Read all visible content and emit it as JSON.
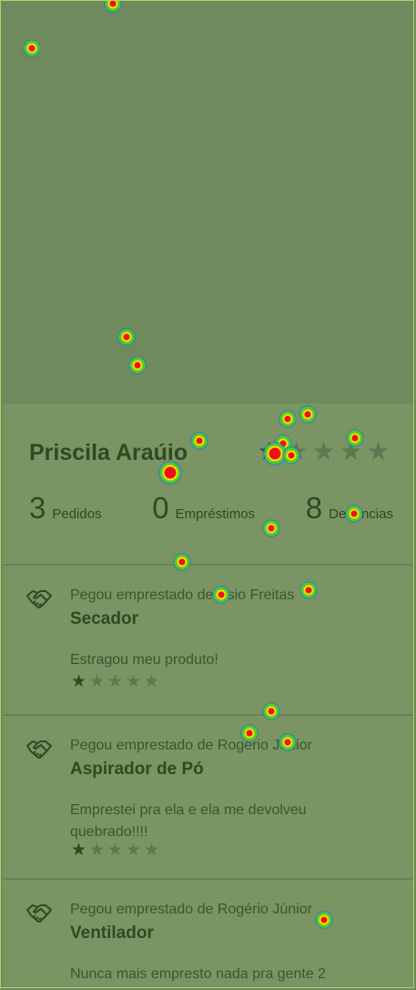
{
  "profile": {
    "name": "Priscila Araúio",
    "rating_filled": 1,
    "rating_max": 5,
    "stats": [
      {
        "count": "3",
        "label": "Pedidos"
      },
      {
        "count": "0",
        "label": "Empréstimos"
      },
      {
        "count": "8",
        "label": "Denúncias"
      }
    ]
  },
  "loans": [
    {
      "lender_text": "Pegou emprestado de Ésio Freitas",
      "item": "Secador",
      "review": "Estragou meu produto!",
      "rating": 1,
      "icon": "handshake-icon"
    },
    {
      "lender_text": "Pegou emprestado de Rogério Júnior",
      "item": "Aspirador de Pó",
      "review": "Emprestei pra ela e ela me devolveu quebrado!!!!",
      "rating": 1,
      "icon": "handshake-icon"
    },
    {
      "lender_text": "Pegou emprestado de Rogério Júnior",
      "item": "Ventilador",
      "review": "Nunca mais empresto nada pra gente 2",
      "rating": null,
      "icon": "handshake-icon"
    }
  ],
  "colors": {
    "background": "#6f8a5c",
    "card": "#7a9463",
    "text_dark": "#2f4a22",
    "heatmap_hot": "#e11111"
  }
}
